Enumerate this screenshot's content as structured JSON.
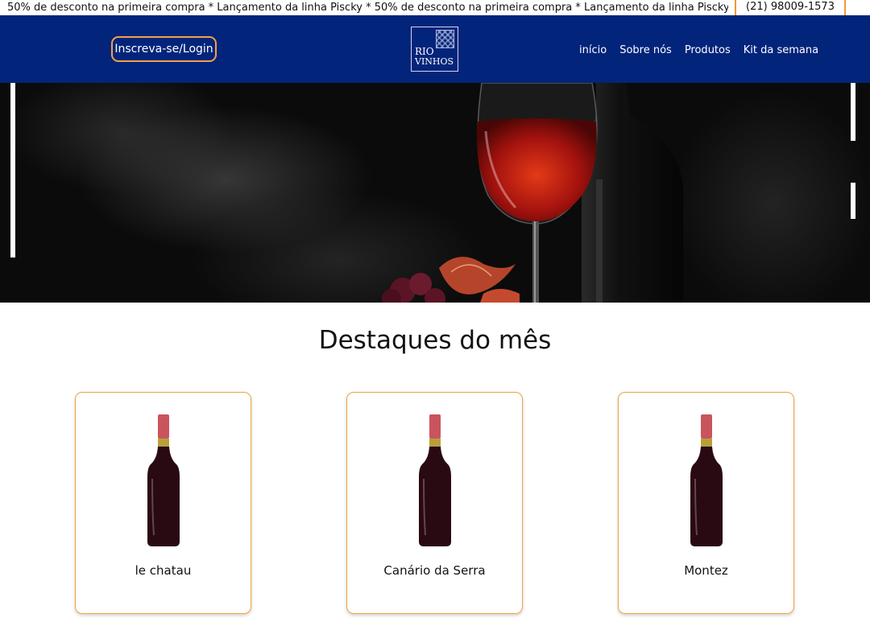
{
  "topbar": {
    "marquee": "50% de desconto na primeira compra * Lançamento da linha Piscky * 50% de desconto na primeira compra * Lançamento da linha Piscky *",
    "phone": "(21) 98009-1573"
  },
  "header": {
    "login_label": "Inscreva-se/Login",
    "logo_line1": "RIO",
    "logo_line2": "VINHOS",
    "nav": [
      "início",
      "Sobre nós",
      "Produtos",
      "Kit da semana"
    ]
  },
  "highlights": {
    "title": "Destaques do mês",
    "products": [
      {
        "name": "le chatau"
      },
      {
        "name": "Canário da Serra"
      },
      {
        "name": "Montez"
      }
    ]
  },
  "colors": {
    "header_bg": "#03247b",
    "accent": "#f2a33f"
  }
}
